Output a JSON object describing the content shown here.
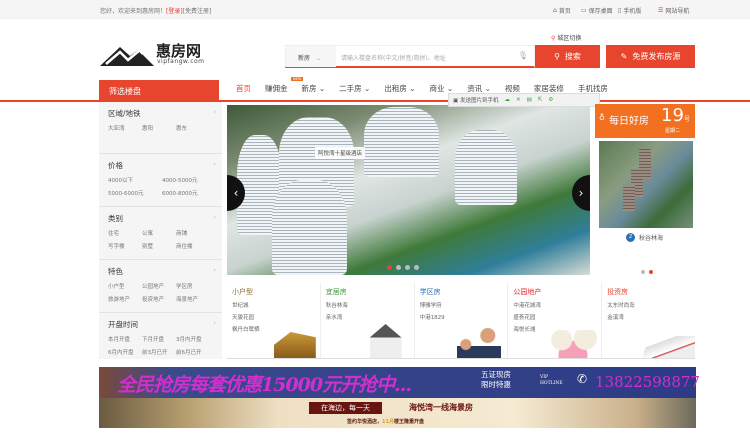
{
  "topbar": {
    "welcome": "您好，欢迎来到惠房网！",
    "login": "[登录]",
    "register": "[免费注册]",
    "links": [
      "首页",
      "保存桌面",
      "手机版",
      "网站导航"
    ]
  },
  "header": {
    "logo_name": "惠房网",
    "logo_url": "vipfangw.com",
    "city": "城区切换",
    "search_type": "新房",
    "search_placeholder": "请输入楼盘名称(中文/拼音/简拼)、地址",
    "search_button": "搜索",
    "post_button": "免费发布房源"
  },
  "nav": {
    "filter_title": "筛选楼盘",
    "items": [
      "首页",
      "赚佣金",
      "新房",
      "二手房",
      "出租房",
      "商业",
      "资讯",
      "视频",
      "家居装修",
      "手机找房"
    ],
    "new_badge": "NEW"
  },
  "toolbar": {
    "send": "发送图片到手机"
  },
  "sidebar": [
    {
      "title": "区域/地铁",
      "items": [
        "大亚湾",
        "惠阳",
        "惠东"
      ]
    },
    {
      "title": "价格",
      "items": [
        "4000以下",
        "4000-5000元",
        "5000-6000元",
        "6000-8000元"
      ]
    },
    {
      "title": "类别",
      "items": [
        "住宅",
        "公寓",
        "商铺",
        "写字楼",
        "别墅",
        "商住楼"
      ]
    },
    {
      "title": "特色",
      "items": [
        "小户型",
        "公园地产",
        "学区房",
        "旅游地产",
        "投资地产",
        "海景地产"
      ]
    },
    {
      "title": "开盘时间",
      "items": [
        "本月开盘",
        "下月开盘",
        "3月内开盘",
        "6月内开盘",
        "前3月已开",
        "前6月已开"
      ]
    }
  ],
  "carousel": {
    "label": "阿悦湾十星级酒店"
  },
  "daily": {
    "title": "每日好房",
    "day": "19",
    "day_unit": "号",
    "weekday": "星期二",
    "badge": "2",
    "caption": "秋谷林海"
  },
  "categories": [
    {
      "title": "小户型",
      "color": "#8a6a2a",
      "items": [
        "世纪城",
        "天骏花园",
        "枫丹白鹭栖"
      ]
    },
    {
      "title": "宜居房",
      "color": "#3a9a3a",
      "items": [
        "秋谷林海",
        "亲水湾"
      ]
    },
    {
      "title": "学区房",
      "color": "#2a6fb8",
      "items": [
        "博雅学府",
        "中港1829"
      ]
    },
    {
      "title": "公园地产",
      "color": "#e8252e",
      "items": [
        "中港花城湾",
        "盛荟花园",
        "海悦长滩"
      ]
    },
    {
      "title": "投资房",
      "color": "#e8452e",
      "items": [
        "太东时尚岛",
        "金溪湾"
      ]
    }
  ],
  "banner1": {
    "headline": "全民抢房每套优惠15000元开抢中...",
    "tag1": "五证现房",
    "tag2": "限时特惠",
    "vip": "VIP",
    "hotline": "HOTLINE",
    "phone": "13822598877"
  },
  "banner2": {
    "slogan": "在海边，每一天",
    "title": "海悦湾一线海景房",
    "sub1": "签约华悦酒店，",
    "sub2": "11月",
    "sub3": "楼王隆重开盘"
  }
}
